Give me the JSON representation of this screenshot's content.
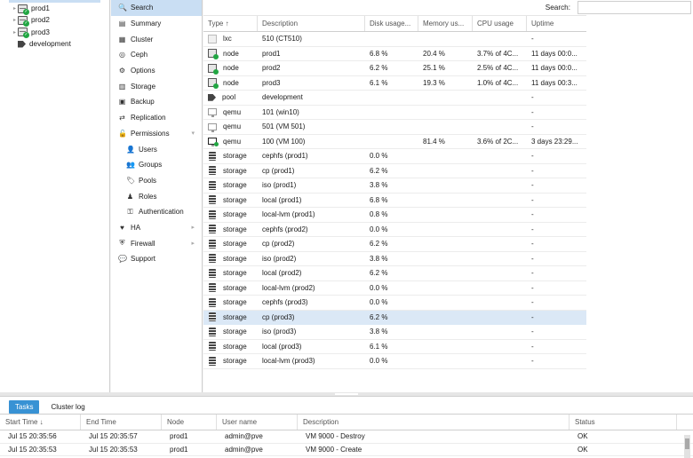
{
  "tree": {
    "nodes": [
      {
        "label": "prod1"
      },
      {
        "label": "prod2"
      },
      {
        "label": "prod3"
      }
    ],
    "pools": [
      {
        "label": "development"
      }
    ]
  },
  "menu": {
    "items": [
      {
        "label": "Search",
        "icon": "search-icon",
        "glyph": "🔍",
        "active": true
      },
      {
        "label": "Summary",
        "icon": "book-icon",
        "glyph": "▤"
      },
      {
        "label": "Cluster",
        "icon": "server-icon",
        "glyph": "▦"
      },
      {
        "label": "Ceph",
        "icon": "ceph-icon",
        "glyph": "◎"
      },
      {
        "label": "Options",
        "icon": "gear-icon",
        "glyph": "⚙"
      },
      {
        "label": "Storage",
        "icon": "database-icon",
        "glyph": "▥"
      },
      {
        "label": "Backup",
        "icon": "floppy-icon",
        "glyph": "▣"
      },
      {
        "label": "Replication",
        "icon": "retweet-icon",
        "glyph": "⇄"
      },
      {
        "label": "Permissions",
        "icon": "unlock-icon",
        "glyph": "🔓",
        "arrow": "▾"
      },
      {
        "label": "Users",
        "icon": "user-icon",
        "glyph": "👤",
        "sub": true
      },
      {
        "label": "Groups",
        "icon": "users-icon",
        "glyph": "👥",
        "sub": true
      },
      {
        "label": "Pools",
        "icon": "tags-icon",
        "glyph": "🏷",
        "sub": true
      },
      {
        "label": "Roles",
        "icon": "male-icon",
        "glyph": "♟",
        "sub": true
      },
      {
        "label": "Authentication",
        "icon": "key-icon",
        "glyph": "⚿",
        "sub": true
      },
      {
        "label": "HA",
        "icon": "heartbeat-icon",
        "glyph": "♥",
        "arrow": "▸"
      },
      {
        "label": "Firewall",
        "icon": "shield-icon",
        "glyph": "⛨",
        "arrow": "▸"
      },
      {
        "label": "Support",
        "icon": "comments-icon",
        "glyph": "💬"
      }
    ]
  },
  "search": {
    "label": "Search:",
    "value": ""
  },
  "grid": {
    "columns": {
      "type": "Type ↑",
      "desc": "Description",
      "disk": "Disk usage...",
      "mem": "Memory us...",
      "cpu": "CPU usage",
      "uptime": "Uptime"
    },
    "rows": [
      {
        "type": "lxc",
        "desc": "510 (CT510)",
        "disk": "",
        "mem": "",
        "cpu": "",
        "uptime": "-"
      },
      {
        "type": "node",
        "desc": "prod1",
        "disk": "6.8 %",
        "mem": "20.4 %",
        "cpu": "3.7% of 4C...",
        "uptime": "11 days 00:0..."
      },
      {
        "type": "node",
        "desc": "prod2",
        "disk": "6.2 %",
        "mem": "25.1 %",
        "cpu": "2.5% of 4C...",
        "uptime": "11 days 00:0..."
      },
      {
        "type": "node",
        "desc": "prod3",
        "disk": "6.1 %",
        "mem": "19.3 %",
        "cpu": "1.0% of 4C...",
        "uptime": "11 days 00:3..."
      },
      {
        "type": "pool",
        "desc": "development",
        "disk": "",
        "mem": "",
        "cpu": "",
        "uptime": "-"
      },
      {
        "type": "qemu",
        "desc": "101 (win10)",
        "disk": "",
        "mem": "",
        "cpu": "",
        "uptime": "-"
      },
      {
        "type": "qemu",
        "desc": "501 (VM 501)",
        "disk": "",
        "mem": "",
        "cpu": "",
        "uptime": "-"
      },
      {
        "type": "qemu",
        "desc": "100 (VM 100)",
        "disk": "",
        "mem": "81.4 %",
        "cpu": "3.6% of 2C...",
        "uptime": "3 days 23:29...",
        "running": true
      },
      {
        "type": "storage",
        "desc": "cephfs (prod1)",
        "disk": "0.0 %",
        "mem": "",
        "cpu": "",
        "uptime": "-"
      },
      {
        "type": "storage",
        "desc": "cp (prod1)",
        "disk": "6.2 %",
        "mem": "",
        "cpu": "",
        "uptime": "-"
      },
      {
        "type": "storage",
        "desc": "iso (prod1)",
        "disk": "3.8 %",
        "mem": "",
        "cpu": "",
        "uptime": "-"
      },
      {
        "type": "storage",
        "desc": "local (prod1)",
        "disk": "6.8 %",
        "mem": "",
        "cpu": "",
        "uptime": "-"
      },
      {
        "type": "storage",
        "desc": "local-lvm (prod1)",
        "disk": "0.8 %",
        "mem": "",
        "cpu": "",
        "uptime": "-"
      },
      {
        "type": "storage",
        "desc": "cephfs (prod2)",
        "disk": "0.0 %",
        "mem": "",
        "cpu": "",
        "uptime": "-"
      },
      {
        "type": "storage",
        "desc": "cp (prod2)",
        "disk": "6.2 %",
        "mem": "",
        "cpu": "",
        "uptime": "-"
      },
      {
        "type": "storage",
        "desc": "iso (prod2)",
        "disk": "3.8 %",
        "mem": "",
        "cpu": "",
        "uptime": "-"
      },
      {
        "type": "storage",
        "desc": "local (prod2)",
        "disk": "6.2 %",
        "mem": "",
        "cpu": "",
        "uptime": "-"
      },
      {
        "type": "storage",
        "desc": "local-lvm (prod2)",
        "disk": "0.0 %",
        "mem": "",
        "cpu": "",
        "uptime": "-"
      },
      {
        "type": "storage",
        "desc": "cephfs (prod3)",
        "disk": "0.0 %",
        "mem": "",
        "cpu": "",
        "uptime": "-"
      },
      {
        "type": "storage",
        "desc": "cp (prod3)",
        "disk": "6.2 %",
        "mem": "",
        "cpu": "",
        "uptime": "-",
        "selected": true
      },
      {
        "type": "storage",
        "desc": "iso (prod3)",
        "disk": "3.8 %",
        "mem": "",
        "cpu": "",
        "uptime": "-"
      },
      {
        "type": "storage",
        "desc": "local (prod3)",
        "disk": "6.1 %",
        "mem": "",
        "cpu": "",
        "uptime": "-"
      },
      {
        "type": "storage",
        "desc": "local-lvm (prod3)",
        "disk": "0.0 %",
        "mem": "",
        "cpu": "",
        "uptime": "-"
      }
    ]
  },
  "bottom": {
    "tabs": [
      {
        "label": "Tasks",
        "active": true
      },
      {
        "label": "Cluster log"
      }
    ],
    "columns": {
      "start": "Start Time ↓",
      "end": "End Time",
      "node": "Node",
      "user": "User name",
      "desc": "Description",
      "status": "Status"
    },
    "rows": [
      {
        "start": "Jul 15 20:35:56",
        "end": "Jul 15 20:35:57",
        "node": "prod1",
        "user": "admin@pve",
        "desc": "VM 9000 - Destroy",
        "status": "OK"
      },
      {
        "start": "Jul 15 20:35:53",
        "end": "Jul 15 20:35:53",
        "node": "prod1",
        "user": "admin@pve",
        "desc": "VM 9000 - Create",
        "status": "OK"
      }
    ]
  },
  "colors": {
    "accent": "#3892d4",
    "selection": "#c9def3",
    "running": "#21a642"
  }
}
